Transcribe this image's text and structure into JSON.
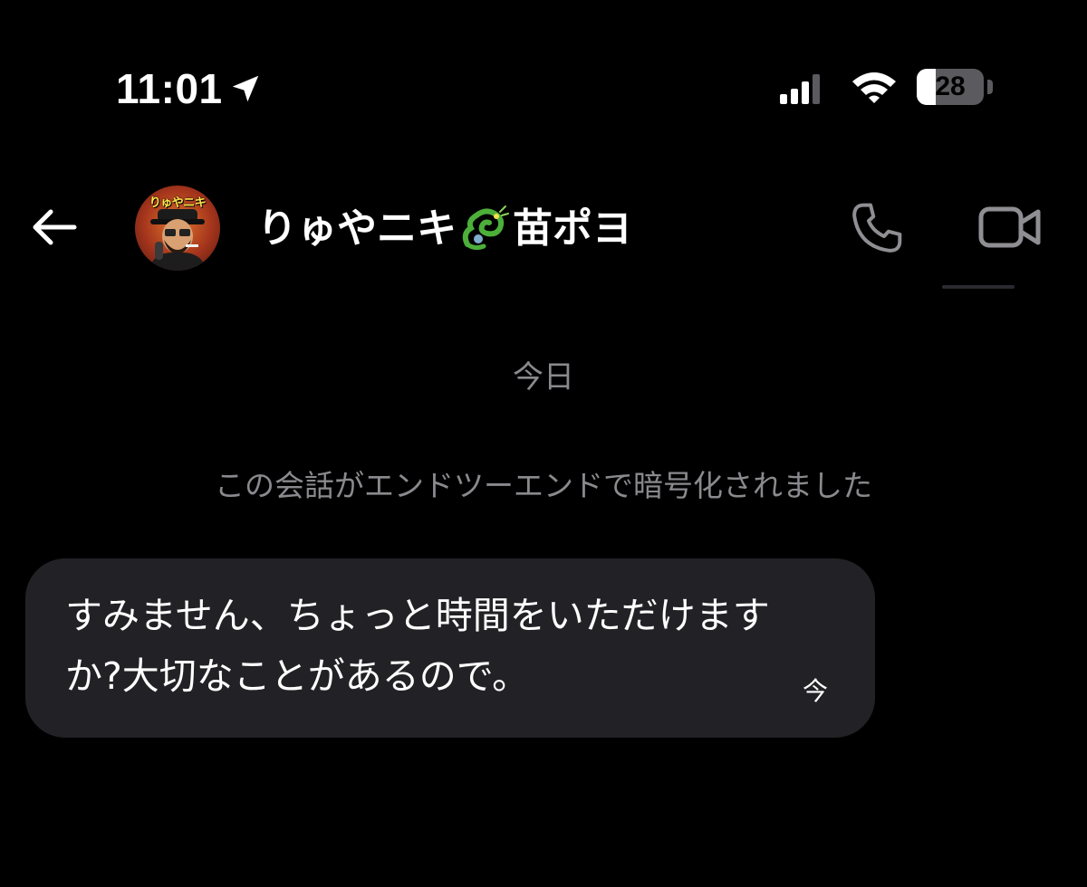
{
  "status_bar": {
    "time": "11:01",
    "battery_level": "28",
    "battery_fraction": 0.28,
    "icons": [
      "location-arrow-icon",
      "cellular-signal-icon",
      "wifi-icon",
      "battery-icon"
    ]
  },
  "header": {
    "back_icon": "back-arrow-icon",
    "contact_name_part1": "りゅやニキ",
    "contact_name_part2": "苗ポヨ",
    "name_emoji_icon": "dragon-icon",
    "avatar_label": "りゅやニキ",
    "call_icon": "phone-icon",
    "video_icon": "video-camera-icon"
  },
  "chat": {
    "date_separator": "今日",
    "encryption_notice": "この会話がエンドツーエンドで暗号化されました",
    "messages": [
      {
        "text": "すみません、ちょっと時間をいただけますか?大切なことがあるので。",
        "time": "今"
      }
    ]
  },
  "colors": {
    "background": "#000000",
    "bubble": "#222226",
    "muted_text": "#8a8a8e",
    "icon_gray": "#8e8e93",
    "text": "#ffffff"
  }
}
